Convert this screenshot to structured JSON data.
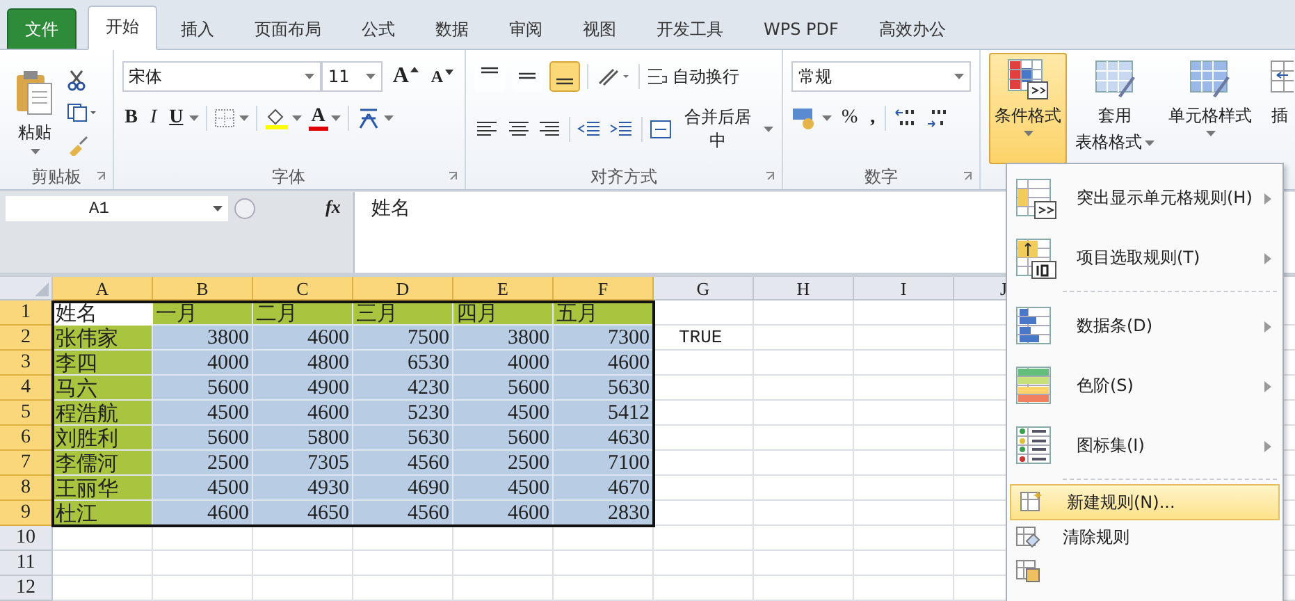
{
  "tabs": [
    {
      "label": "文件",
      "kind": "file",
      "selected": false
    },
    {
      "label": "开始",
      "kind": "tab",
      "selected": true
    },
    {
      "label": "插入",
      "kind": "tab",
      "selected": false
    },
    {
      "label": "页面布局",
      "kind": "tab",
      "selected": false
    },
    {
      "label": "公式",
      "kind": "tab",
      "selected": false
    },
    {
      "label": "数据",
      "kind": "tab",
      "selected": false
    },
    {
      "label": "审阅",
      "kind": "tab",
      "selected": false
    },
    {
      "label": "视图",
      "kind": "tab",
      "selected": false
    },
    {
      "label": "开发工具",
      "kind": "tab",
      "selected": false
    },
    {
      "label": "WPS PDF",
      "kind": "tab",
      "selected": false
    },
    {
      "label": "高效办公",
      "kind": "tab",
      "selected": false
    }
  ],
  "clipboard": {
    "paste": "粘贴",
    "group_label": "剪贴板"
  },
  "font": {
    "name": "宋体",
    "size": "11",
    "grow": "A",
    "shrink": "A",
    "bold": "B",
    "italic": "I",
    "underline": "U",
    "font_color": "A",
    "group_label": "字体"
  },
  "alignment": {
    "vertical": [
      {
        "kind": "top",
        "selected": false
      },
      {
        "kind": "middle",
        "selected": false
      },
      {
        "kind": "bottom",
        "selected": true
      }
    ],
    "wrap": "自动换行",
    "merge": "合并后居中",
    "group_label": "对齐方式"
  },
  "number": {
    "format": "常规",
    "percent": "%",
    "comma": ",",
    "group_label": "数字"
  },
  "styles": {
    "buttons": [
      {
        "kind": "conditional",
        "lines": [
          "条件格式"
        ],
        "selected": true
      },
      {
        "kind": "table",
        "lines": [
          "套用",
          "表格格式"
        ],
        "selected": false
      },
      {
        "kind": "cell",
        "lines": [
          "单元格样式"
        ],
        "selected": false
      }
    ]
  },
  "insert_partial": "插",
  "formula_bar": {
    "name_box": "A1",
    "fx": "fx",
    "value": "姓名"
  },
  "sheet": {
    "columns": [
      {
        "label": "A",
        "selected": true
      },
      {
        "label": "B",
        "selected": true
      },
      {
        "label": "C",
        "selected": true
      },
      {
        "label": "D",
        "selected": true
      },
      {
        "label": "E",
        "selected": true
      },
      {
        "label": "F",
        "selected": true
      },
      {
        "label": "G",
        "selected": false
      },
      {
        "label": "H",
        "selected": false
      },
      {
        "label": "I",
        "selected": false
      },
      {
        "label": "J",
        "selected": false
      }
    ],
    "rows": [
      {
        "header": "1",
        "selected": true,
        "cells": [
          {
            "text": "姓名",
            "kind": "text"
          },
          {
            "text": "一月",
            "kind": "text",
            "color": "#a9c43f"
          },
          {
            "text": "二月",
            "kind": "text",
            "color": "#a9c43f"
          },
          {
            "text": "三月",
            "kind": "text",
            "color": "#a9c43f"
          },
          {
            "text": "四月",
            "kind": "text",
            "color": "#a9c43f"
          },
          {
            "text": "五月",
            "kind": "text",
            "color": "#a9c43f"
          }
        ]
      },
      {
        "header": "2",
        "selected": true,
        "column_g": "TRUE",
        "cells": [
          {
            "text": "张伟家",
            "kind": "text",
            "color": "#a9c43f"
          },
          {
            "text": "3800",
            "kind": "number",
            "color": "#b8cce4"
          },
          {
            "text": "4600",
            "kind": "number",
            "color": "#b8cce4"
          },
          {
            "text": "7500",
            "kind": "number",
            "color": "#b8cce4"
          },
          {
            "text": "3800",
            "kind": "number",
            "color": "#b8cce4"
          },
          {
            "text": "7300",
            "kind": "number",
            "color": "#b8cce4"
          }
        ]
      },
      {
        "header": "3",
        "selected": true,
        "cells": [
          {
            "text": "李四",
            "kind": "text",
            "color": "#a9c43f"
          },
          {
            "text": "4000",
            "kind": "number",
            "color": "#b8cce4"
          },
          {
            "text": "4800",
            "kind": "number",
            "color": "#b8cce4"
          },
          {
            "text": "6530",
            "kind": "number",
            "color": "#b8cce4"
          },
          {
            "text": "4000",
            "kind": "number",
            "color": "#b8cce4"
          },
          {
            "text": "4600",
            "kind": "number",
            "color": "#b8cce4"
          }
        ]
      },
      {
        "header": "4",
        "selected": true,
        "cells": [
          {
            "text": "马六",
            "kind": "text",
            "color": "#a9c43f"
          },
          {
            "text": "5600",
            "kind": "number",
            "color": "#b8cce4"
          },
          {
            "text": "4900",
            "kind": "number",
            "color": "#b8cce4"
          },
          {
            "text": "4230",
            "kind": "number",
            "color": "#b8cce4"
          },
          {
            "text": "5600",
            "kind": "number",
            "color": "#b8cce4"
          },
          {
            "text": "5630",
            "kind": "number",
            "color": "#b8cce4"
          }
        ]
      },
      {
        "header": "5",
        "selected": true,
        "cells": [
          {
            "text": "程浩航",
            "kind": "text",
            "color": "#a9c43f"
          },
          {
            "text": "4500",
            "kind": "number",
            "color": "#b8cce4"
          },
          {
            "text": "4600",
            "kind": "number",
            "color": "#b8cce4"
          },
          {
            "text": "5230",
            "kind": "number",
            "color": "#b8cce4"
          },
          {
            "text": "4500",
            "kind": "number",
            "color": "#b8cce4"
          },
          {
            "text": "5412",
            "kind": "number",
            "color": "#b8cce4"
          }
        ]
      },
      {
        "header": "6",
        "selected": true,
        "cells": [
          {
            "text": "刘胜利",
            "kind": "text",
            "color": "#a9c43f"
          },
          {
            "text": "5600",
            "kind": "number",
            "color": "#b8cce4"
          },
          {
            "text": "5800",
            "kind": "number",
            "color": "#b8cce4"
          },
          {
            "text": "5630",
            "kind": "number",
            "color": "#b8cce4"
          },
          {
            "text": "5600",
            "kind": "number",
            "color": "#b8cce4"
          },
          {
            "text": "4630",
            "kind": "number",
            "color": "#b8cce4"
          }
        ]
      },
      {
        "header": "7",
        "selected": true,
        "cells": [
          {
            "text": "李儒河",
            "kind": "text",
            "color": "#a9c43f"
          },
          {
            "text": "2500",
            "kind": "number",
            "color": "#b8cce4"
          },
          {
            "text": "7305",
            "kind": "number",
            "color": "#b8cce4"
          },
          {
            "text": "4560",
            "kind": "number",
            "color": "#b8cce4"
          },
          {
            "text": "2500",
            "kind": "number",
            "color": "#b8cce4"
          },
          {
            "text": "7100",
            "kind": "number",
            "color": "#b8cce4"
          }
        ]
      },
      {
        "header": "8",
        "selected": true,
        "cells": [
          {
            "text": "王丽华",
            "kind": "text",
            "color": "#a9c43f"
          },
          {
            "text": "4500",
            "kind": "number",
            "color": "#b8cce4"
          },
          {
            "text": "4930",
            "kind": "number",
            "color": "#b8cce4"
          },
          {
            "text": "4690",
            "kind": "number",
            "color": "#b8cce4"
          },
          {
            "text": "4500",
            "kind": "number",
            "color": "#b8cce4"
          },
          {
            "text": "4670",
            "kind": "number",
            "color": "#b8cce4"
          }
        ]
      },
      {
        "header": "9",
        "selected": true,
        "cells": [
          {
            "text": "杜江",
            "kind": "text",
            "color": "#a9c43f"
          },
          {
            "text": "4600",
            "kind": "number",
            "color": "#b8cce4"
          },
          {
            "text": "4650",
            "kind": "number",
            "color": "#b8cce4"
          },
          {
            "text": "4560",
            "kind": "number",
            "color": "#b8cce4"
          },
          {
            "text": "4600",
            "kind": "number",
            "color": "#b8cce4"
          },
          {
            "text": "2830",
            "kind": "number",
            "color": "#b8cce4"
          }
        ]
      },
      {
        "header": "10",
        "selected": false,
        "cells": []
      },
      {
        "header": "11",
        "selected": false,
        "cells": []
      },
      {
        "header": "12",
        "selected": false,
        "cells": []
      }
    ]
  },
  "menu": {
    "items": [
      {
        "kind": "highlight",
        "label": "突出显示单元格规则(H)",
        "submenu": true,
        "selected": false
      },
      {
        "kind": "topn",
        "label": "项目选取规则(T)",
        "submenu": true,
        "selected": false
      },
      {
        "kind": "databar",
        "label": "数据条(D)",
        "submenu": true,
        "selected": false
      },
      {
        "kind": "colorscale",
        "label": "色阶(S)",
        "submenu": true,
        "selected": false
      },
      {
        "kind": "iconset",
        "label": "图标集(I)",
        "submenu": true,
        "selected": false
      },
      {
        "kind": "new",
        "label": "新建规则(N)...",
        "submenu": false,
        "selected": true
      },
      {
        "kind": "clear",
        "label": "清除规则",
        "submenu": false,
        "selected": false
      },
      {
        "kind": "manage",
        "submenu": false,
        "selected": false
      }
    ]
  }
}
